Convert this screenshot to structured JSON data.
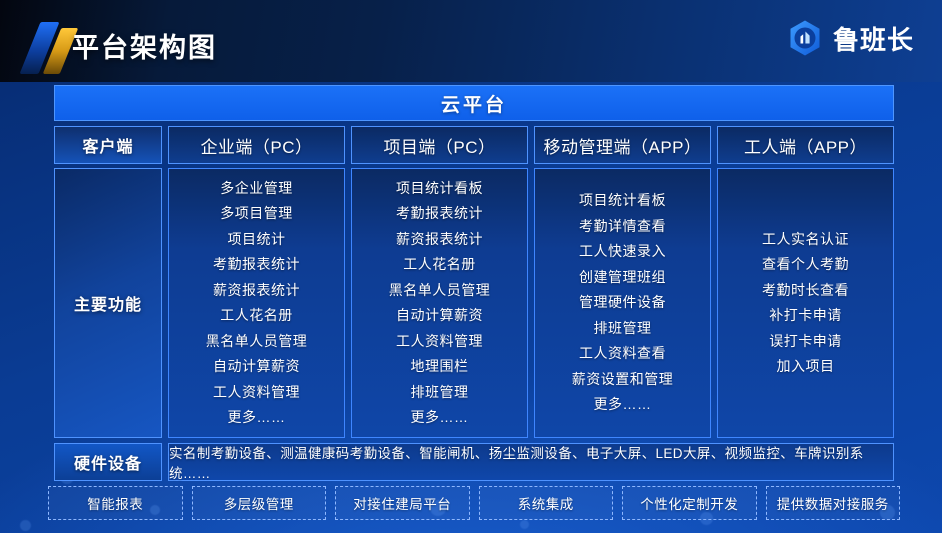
{
  "header": {
    "title": "平台架构图",
    "brand_name": "鲁班长",
    "logo_icon": "hexagon-building-icon",
    "decor_icon": "slash-mark-icon"
  },
  "cloud_bar": {
    "label": "云平台"
  },
  "table": {
    "row_labels": {
      "client": "客户端",
      "main_functions": "主要功能",
      "hardware": "硬件设备"
    },
    "columns": [
      {
        "header": "企业端（PC）",
        "items": [
          "多企业管理",
          "多项目管理",
          "项目统计",
          "考勤报表统计",
          "薪资报表统计",
          "工人花名册",
          "黑名单人员管理",
          "自动计算薪资",
          "工人资料管理",
          "更多……"
        ]
      },
      {
        "header": "项目端（PC）",
        "items": [
          "项目统计看板",
          "考勤报表统计",
          "薪资报表统计",
          "工人花名册",
          "黑名单人员管理",
          "自动计算薪资",
          "工人资料管理",
          "地理围栏",
          "排班管理",
          "更多……"
        ]
      },
      {
        "header": "移动管理端（APP）",
        "items": [
          "项目统计看板",
          "考勤详情查看",
          "工人快速录入",
          "创建管理班组",
          "管理硬件设备",
          "排班管理",
          "工人资料查看",
          "薪资设置和管理",
          "更多……"
        ]
      },
      {
        "header": "工人端（APP）",
        "items": [
          "工人实名认证",
          "查看个人考勤",
          "考勤时长查看",
          "补打卡申请",
          "误打卡申请",
          "加入项目"
        ]
      }
    ],
    "hardware_list": "实名制考勤设备、测温健康码考勤设备、智能闸机、扬尘监测设备、电子大屏、LED大屏、视频监控、车牌识别系统……"
  },
  "services": [
    "智能报表",
    "多层级管理",
    "对接住建局平台",
    "系统集成",
    "个性化定制开发",
    "提供数据对接服务"
  ],
  "colors": {
    "accent_blue": "#1668f0",
    "panel_blue": "#0f46a8",
    "border_blue": "#4f93ff",
    "header_dark": "#03060f",
    "gold": "#ffc83a"
  }
}
